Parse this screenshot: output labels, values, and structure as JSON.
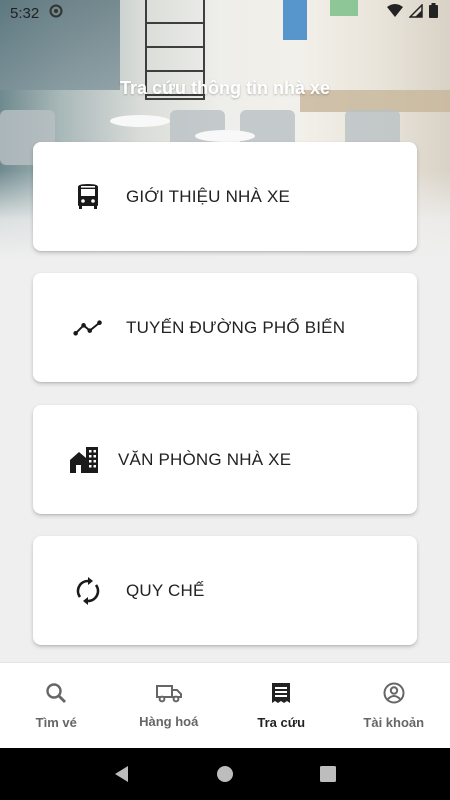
{
  "status_bar": {
    "time": "5:32",
    "icons": [
      "notification-icon",
      "wifi-icon",
      "signal-icon",
      "battery-icon"
    ]
  },
  "header": {
    "title": "Tra cứu thông tin nhà xe"
  },
  "menu": [
    {
      "label": "GIỚI THIỆU NHÀ XE",
      "icon": "bus-icon"
    },
    {
      "label": "TUYẾN ĐƯỜNG PHỔ BIẾN",
      "icon": "route-trend-icon"
    },
    {
      "label": "VĂN PHÒNG NHÀ XE",
      "icon": "office-building-icon"
    },
    {
      "label": "QUY CHẾ",
      "icon": "sync-icon"
    }
  ],
  "bottom_nav": {
    "active_index": 2,
    "items": [
      {
        "label": "Tìm vé",
        "icon": "search-icon"
      },
      {
        "label": "Hàng hoá",
        "icon": "truck-icon"
      },
      {
        "label": "Tra cứu",
        "icon": "receipt-icon"
      },
      {
        "label": "Tài khoản",
        "icon": "account-icon"
      }
    ]
  },
  "system_nav": [
    "back-icon",
    "home-icon",
    "recents-icon"
  ],
  "colors": {
    "card_bg": "#ffffff",
    "page_bg": "#efefef",
    "icon": "#1a1a1a",
    "nav_inactive": "#666666",
    "nav_active": "#222222"
  }
}
